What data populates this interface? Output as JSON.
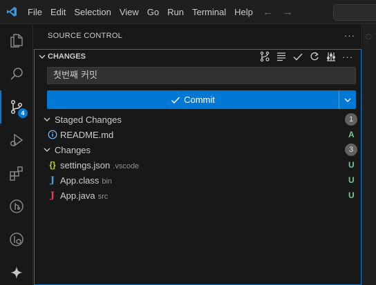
{
  "titlebar": {
    "menu": [
      "File",
      "Edit",
      "Selection",
      "View",
      "Go",
      "Run",
      "Terminal",
      "Help"
    ]
  },
  "activitybar": {
    "scm_badge": "4"
  },
  "sidebar": {
    "title": "SOURCE CONTROL",
    "section_title": "CHANGES",
    "commit_message": "첫번째 커밋",
    "commit_label": "Commit",
    "staged": {
      "label": "Staged Changes",
      "count": "1",
      "files": [
        {
          "name": "README.md",
          "dir": "",
          "status": "A",
          "icon": "info-icon"
        }
      ]
    },
    "changes": {
      "label": "Changes",
      "count": "3",
      "files": [
        {
          "name": "settings.json",
          "dir": ".vscode",
          "status": "U",
          "icon": "json-braces-icon"
        },
        {
          "name": "App.class",
          "dir": "bin",
          "status": "U",
          "icon": "java-class-icon"
        },
        {
          "name": "App.java",
          "dir": "src",
          "status": "U",
          "icon": "java-icon"
        }
      ]
    }
  },
  "colors": {
    "accent": "#0078d4",
    "untracked": "#73c991",
    "json_icon": "#cbcb41",
    "java_icon": "#e3424c",
    "class_icon": "#4d9bd6",
    "info_icon": "#75beff"
  }
}
